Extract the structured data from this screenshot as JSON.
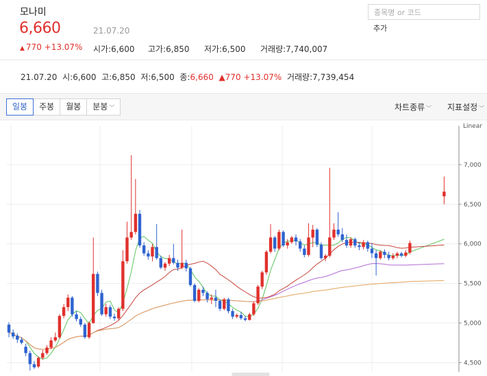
{
  "stock": {
    "name": "모나미",
    "price": "6,660",
    "date": "21.07.20",
    "change": "770 +13.07%",
    "open_label": "시가",
    "open": "6,600",
    "high_label": "고가",
    "high": "6,850",
    "low_label": "저가",
    "low": "6,500",
    "volume_label": "거래량",
    "volume": "7,740,007"
  },
  "search": {
    "placeholder": "종목명 or 코드",
    "add_label": "추가"
  },
  "summary": {
    "date": "21.07.20",
    "o_label": "시",
    "o": "6,600",
    "h_label": "고",
    "h": "6,850",
    "l_label": "저",
    "l": "6,500",
    "c_label": "종",
    "c": "6,660",
    "change": "770 +13.07%",
    "v_label": "거래량",
    "v": "7,739,454"
  },
  "toolbar": {
    "tabs": [
      "일봉",
      "주봉",
      "월봉",
      "분봉"
    ],
    "chart_type": "차트종류",
    "indicator": "지표설정"
  },
  "colors": {
    "up": "#e0312d",
    "down": "#2f63d0",
    "ma5": "#5cc35c",
    "ma20": "#c9443a",
    "ma60": "#b36bd6",
    "ma120": "#e2a55a"
  },
  "chart_data": {
    "type": "candlestick",
    "scale": "Linear",
    "y_ticks": [
      4500,
      5000,
      5500,
      6000,
      6500,
      7000
    ],
    "ylim": [
      4480,
      7500
    ],
    "x_date_last": "21.07.20",
    "grid": true,
    "candles": [
      [
        4980,
        4880,
        5010,
        4820
      ],
      [
        4880,
        4830,
        4920,
        4800
      ],
      [
        4840,
        4790,
        4870,
        4750
      ],
      [
        4790,
        4750,
        4820,
        4730
      ],
      [
        4700,
        4620,
        4740,
        4580
      ],
      [
        4620,
        4480,
        4650,
        4400
      ],
      [
        4480,
        4440,
        4520,
        4420
      ],
      [
        4450,
        4560,
        4580,
        4430
      ],
      [
        4560,
        4620,
        4660,
        4540
      ],
      [
        4620,
        4690,
        4720,
        4600
      ],
      [
        4690,
        4780,
        4820,
        4670
      ],
      [
        4780,
        4820,
        4880,
        4760
      ],
      [
        4820,
        5090,
        5110,
        4800
      ],
      [
        5090,
        5200,
        5240,
        5060
      ],
      [
        5200,
        5320,
        5360,
        5150
      ],
      [
        5320,
        5110,
        5340,
        5080
      ],
      [
        5110,
        5050,
        5150,
        5020
      ],
      [
        5050,
        4980,
        5080,
        4950
      ],
      [
        4980,
        4820,
        5000,
        4800
      ],
      [
        4820,
        5000,
        5020,
        4800
      ],
      [
        5000,
        5620,
        6080,
        4990
      ],
      [
        5620,
        5380,
        5650,
        5340
      ],
      [
        5380,
        5110,
        5420,
        5090
      ],
      [
        5110,
        5200,
        5240,
        5080
      ],
      [
        5200,
        5080,
        5230,
        5050
      ],
      [
        5080,
        5060,
        5120,
        5030
      ],
      [
        5060,
        5180,
        5200,
        5040
      ],
      [
        5180,
        5780,
        5920,
        5150
      ],
      [
        5780,
        6080,
        6280,
        5750
      ],
      [
        6080,
        6150,
        7120,
        6050
      ],
      [
        6150,
        6380,
        6820,
        6120
      ],
      [
        6380,
        5980,
        6430,
        5950
      ],
      [
        5980,
        5880,
        6020,
        5850
      ],
      [
        5880,
        5840,
        5920,
        5800
      ],
      [
        5840,
        5960,
        6000,
        5780
      ],
      [
        5960,
        5820,
        6250,
        5800
      ],
      [
        5820,
        5700,
        5850,
        5680
      ],
      [
        5700,
        5750,
        5770,
        5660
      ],
      [
        5750,
        5820,
        5860,
        5720
      ],
      [
        5820,
        5760,
        6000,
        5740
      ],
      [
        5760,
        5700,
        5800,
        5660
      ],
      [
        5700,
        5760,
        6180,
        5680
      ],
      [
        5760,
        5690,
        5800,
        5650
      ],
      [
        5690,
        5480,
        5710,
        5460
      ],
      [
        5480,
        5280,
        5500,
        5260
      ],
      [
        5280,
        5420,
        5440,
        5260
      ],
      [
        5420,
        5380,
        5460,
        5340
      ],
      [
        5380,
        5300,
        5400,
        5260
      ],
      [
        5300,
        5320,
        5360,
        5240
      ],
      [
        5320,
        5280,
        5420,
        5200
      ],
      [
        5280,
        5180,
        5300,
        5150
      ],
      [
        5180,
        5300,
        5320,
        5160
      ],
      [
        5300,
        5150,
        5320,
        5120
      ],
      [
        5150,
        5080,
        5180,
        5050
      ],
      [
        5080,
        5100,
        5120,
        5060
      ],
      [
        5100,
        5060,
        5140,
        5040
      ],
      [
        5060,
        5040,
        5090,
        5020
      ],
      [
        5040,
        5110,
        5130,
        5030
      ],
      [
        5110,
        5250,
        5270,
        5090
      ],
      [
        5250,
        5460,
        5480,
        5230
      ],
      [
        5460,
        5640,
        5660,
        5430
      ],
      [
        5640,
        5900,
        5920,
        5610
      ],
      [
        5900,
        6080,
        6250,
        5880
      ],
      [
        6080,
        5940,
        6100,
        5900
      ],
      [
        5940,
        6150,
        6180,
        5920
      ],
      [
        6150,
        5980,
        6170,
        5960
      ],
      [
        5980,
        6020,
        6060,
        5940
      ],
      [
        6020,
        6080,
        6100,
        6000
      ],
      [
        6080,
        6030,
        6120,
        5980
      ],
      [
        6030,
        5940,
        6060,
        5900
      ],
      [
        5940,
        5860,
        5980,
        5830
      ],
      [
        5860,
        6080,
        6260,
        5840
      ],
      [
        6080,
        6180,
        6240,
        5960
      ],
      [
        6180,
        5990,
        6200,
        5960
      ],
      [
        5990,
        5820,
        6020,
        5800
      ],
      [
        5820,
        5850,
        5870,
        5780
      ],
      [
        5850,
        6080,
        6960,
        5830
      ],
      [
        6080,
        6180,
        6260,
        6050
      ],
      [
        6180,
        6120,
        6400,
        6090
      ],
      [
        6120,
        6050,
        6200,
        6020
      ],
      [
        6050,
        5980,
        6120,
        5950
      ],
      [
        5980,
        6060,
        6080,
        5950
      ],
      [
        6060,
        5980,
        6080,
        5950
      ],
      [
        5980,
        5960,
        6020,
        5920
      ],
      [
        5960,
        6020,
        6050,
        5930
      ],
      [
        6020,
        5940,
        6040,
        5900
      ],
      [
        5940,
        5880,
        6010,
        5820
      ],
      [
        5880,
        5820,
        5920,
        5600
      ],
      [
        5820,
        5900,
        5920,
        5800
      ],
      [
        5900,
        5860,
        5930,
        5820
      ],
      [
        5860,
        5820,
        5900,
        5790
      ],
      [
        5820,
        5850,
        5880,
        5800
      ],
      [
        5850,
        5880,
        5900,
        5820
      ],
      [
        5880,
        5850,
        5900,
        5830
      ],
      [
        5850,
        5890,
        5920,
        5830
      ],
      [
        5890,
        6010,
        6040,
        5870
      ],
      [
        6600,
        6660,
        6850,
        6500
      ]
    ],
    "ma_periods": [
      5,
      20,
      60,
      120
    ]
  }
}
